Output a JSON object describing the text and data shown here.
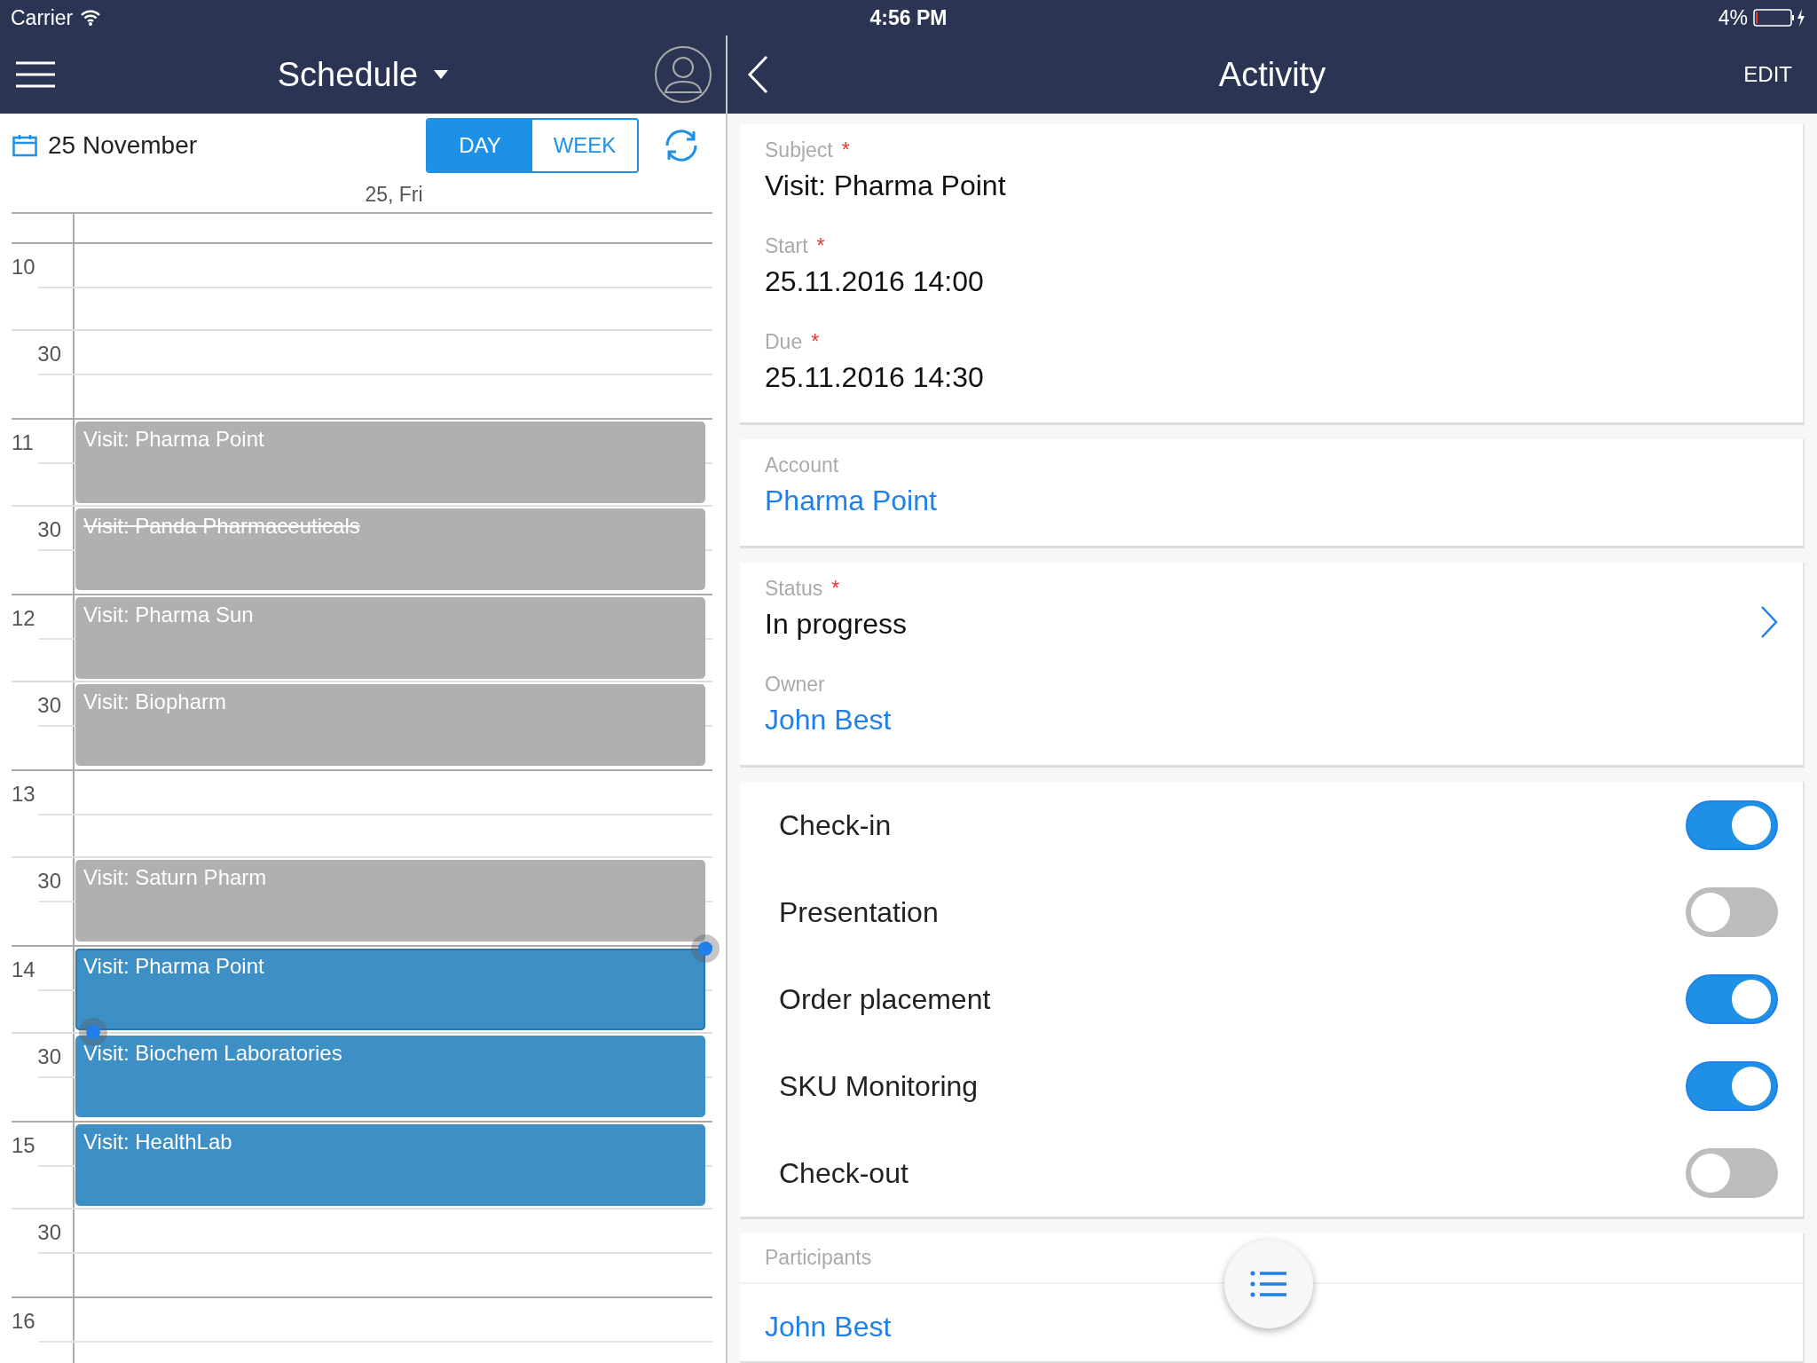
{
  "status_bar": {
    "carrier": "Carrier",
    "time": "4:56 PM",
    "battery": "4%"
  },
  "schedule": {
    "title": "Schedule",
    "date": "25 November",
    "view_tabs": [
      {
        "label": "DAY",
        "selected": true
      },
      {
        "label": "WEEK",
        "selected": false
      }
    ],
    "day_header": "25, Fri",
    "rows": [
      {
        "label": "10",
        "event": null
      },
      {
        "label": "30",
        "event": null
      },
      {
        "label": "11",
        "event": {
          "title": "Visit: Pharma Point",
          "color": "#b0b0b0",
          "cancelled": false,
          "selected": false
        }
      },
      {
        "label": "30",
        "event": {
          "title": "Visit: Panda Pharmaceuticals",
          "color": "#b0b0b0",
          "cancelled": true,
          "selected": false
        }
      },
      {
        "label": "12",
        "event": {
          "title": "Visit: Pharma Sun",
          "color": "#b0b0b0",
          "cancelled": false,
          "selected": false
        }
      },
      {
        "label": "30",
        "event": {
          "title": "Visit: Biopharm",
          "color": "#b0b0b0",
          "cancelled": false,
          "selected": false
        }
      },
      {
        "label": "13",
        "event": null
      },
      {
        "label": "30",
        "event": {
          "title": "Visit: Saturn Pharm",
          "color": "#b0b0b0",
          "cancelled": false,
          "selected": false
        }
      },
      {
        "label": "14",
        "event": {
          "title": "Visit: Pharma Point",
          "color": "#3d8fc6",
          "cancelled": false,
          "selected": true
        }
      },
      {
        "label": "30",
        "event": {
          "title": "Visit: Biochem Laboratories",
          "color": "#3d8fc6",
          "cancelled": false,
          "selected": false
        }
      },
      {
        "label": "15",
        "event": {
          "title": "Visit: HealthLab",
          "color": "#3d8fc6",
          "cancelled": false,
          "selected": false
        }
      },
      {
        "label": "30",
        "event": null
      },
      {
        "label": "16",
        "event": null
      }
    ]
  },
  "activity": {
    "title": "Activity",
    "edit": "EDIT",
    "cards": [
      {
        "fields": [
          {
            "label": "Subject",
            "required_mark": "*",
            "value": "Visit: Pharma Point",
            "kind": "text",
            "disclosure": false
          },
          {
            "label": "Start",
            "required_mark": "*",
            "value": "25.11.2016 14:00",
            "kind": "text",
            "disclosure": false
          },
          {
            "label": "Due",
            "required_mark": "*",
            "value": "25.11.2016 14:30",
            "kind": "text",
            "disclosure": false
          }
        ]
      },
      {
        "fields": [
          {
            "label": "Account",
            "value": "Pharma Point",
            "kind": "link",
            "disclosure": false
          }
        ]
      },
      {
        "fields": [
          {
            "label": "Status",
            "required_mark": "*",
            "value": "In progress",
            "kind": "text",
            "disclosure": true
          },
          {
            "label": "Owner",
            "value": "John Best",
            "kind": "link",
            "disclosure": false
          }
        ]
      }
    ],
    "toggles": [
      {
        "label": "Check-in",
        "on": true
      },
      {
        "label": "Presentation",
        "on": false
      },
      {
        "label": "Order placement",
        "on": true
      },
      {
        "label": "SKU Monitoring",
        "on": true
      },
      {
        "label": "Check-out",
        "on": false
      }
    ],
    "participants": {
      "label": "Participants",
      "people": [
        "John Best"
      ]
    }
  }
}
